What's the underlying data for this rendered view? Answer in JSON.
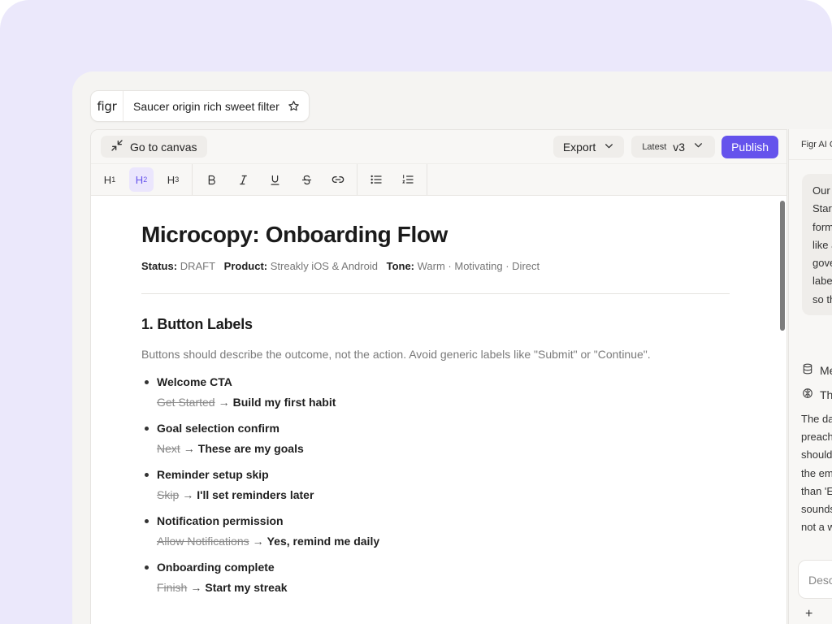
{
  "app": {
    "logo": "figr",
    "file_name": "Saucer origin rich sweet filter"
  },
  "topbar": {
    "canvas_label": "Go to canvas",
    "export_label": "Export",
    "version_tag": "Latest",
    "version": "v3",
    "publish_label": "Publish"
  },
  "toolbar": {
    "h1": "H",
    "h1_sub": "1",
    "h2": "H",
    "h2_sub": "2",
    "h3": "H",
    "h3_sub": "3"
  },
  "doc": {
    "title": "Microcopy: Onboarding Flow",
    "status_label": "Status:",
    "status_value": "DRAFT",
    "product_label": "Product:",
    "product_value": "Streakly iOS & Android",
    "tone_label": "Tone:",
    "tone_value": "Warm · Motivating · Direct",
    "section_title": "1. Button Labels",
    "intro": "Buttons should describe the outcome, not the action. Avoid generic labels like \"Submit\" or \"Continue\".",
    "items": [
      {
        "title": "Welcome CTA",
        "old": "Get Started",
        "new": "Build my first habit"
      },
      {
        "title": "Goal selection confirm",
        "old": "Next",
        "new": "These are my goals"
      },
      {
        "title": "Reminder setup skip",
        "old": "Skip",
        "new": "I'll set reminders later"
      },
      {
        "title": "Notification permission",
        "old": "Allow Notifications",
        "new": "Yes, remind me daily"
      },
      {
        "title": "Onboarding complete",
        "old": "Finish",
        "new": "Start my streak"
      }
    ],
    "arrow": "→"
  },
  "ai_panel": {
    "header": "Figr AI C",
    "bubble_lines": [
      "Our",
      "Star",
      "form",
      "like a",
      "gove",
      "labe",
      "so th"
    ],
    "row1": "Me",
    "row2": "The",
    "text_lines": [
      "The da",
      "preach",
      "should",
      "the em",
      "than 'E",
      "sounds",
      "not a w"
    ],
    "input_placeholder": "Desc",
    "plus": "+"
  },
  "colors": {
    "accent": "#6553ec",
    "frame_bg": "#ebe8fb"
  }
}
